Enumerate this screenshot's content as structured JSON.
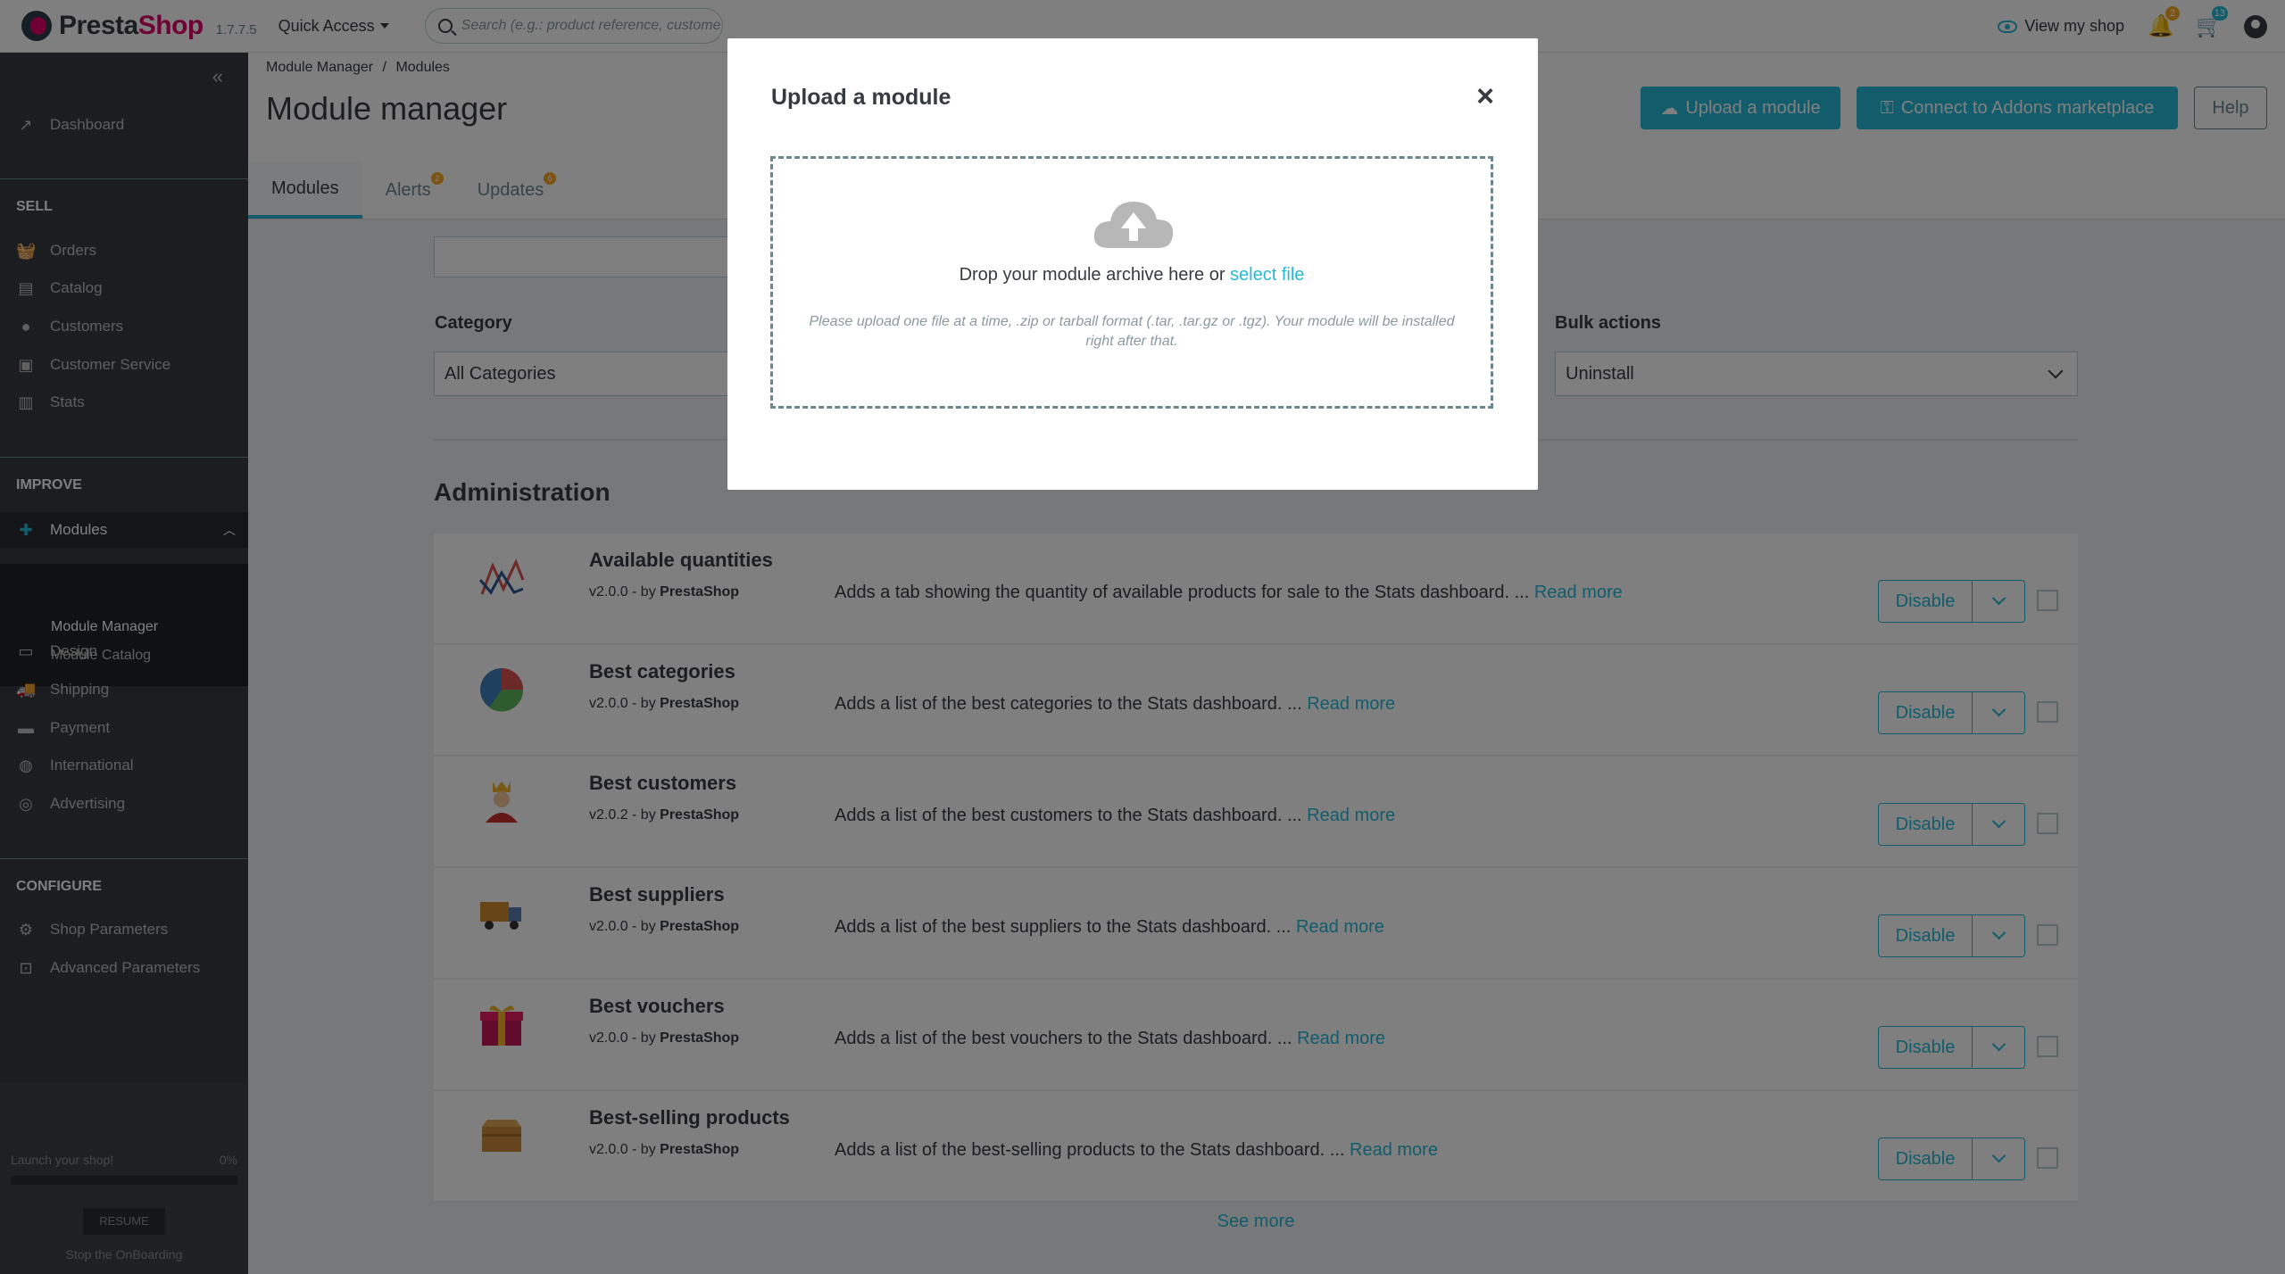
{
  "header": {
    "brand_a": "Presta",
    "brand_b": "Shop",
    "version": "1.7.7.5",
    "quick_access": "Quick Access",
    "search_placeholder": "Search (e.g.: product reference, custome",
    "view_shop": "View my shop",
    "notif_badge_1": "2",
    "notif_badge_2": "13"
  },
  "sidebar": {
    "dashboard": "Dashboard",
    "sell": "SELL",
    "orders": "Orders",
    "catalog": "Catalog",
    "customers": "Customers",
    "customer_service": "Customer Service",
    "stats": "Stats",
    "improve": "IMPROVE",
    "modules": "Modules",
    "module_manager": "Module Manager",
    "module_catalog": "Module Catalog",
    "design": "Design",
    "shipping": "Shipping",
    "payment": "Payment",
    "international": "International",
    "advertising": "Advertising",
    "configure": "CONFIGURE",
    "shop_parameters": "Shop Parameters",
    "advanced_parameters": "Advanced Parameters",
    "onboarding_label": "Launch your shop!",
    "onboarding_pct": "0%",
    "onboarding_progress": 0,
    "resume": "RESUME",
    "stop": "Stop the OnBoarding"
  },
  "page": {
    "breadcrumb_1": "Module Manager",
    "breadcrumb_sep": "/",
    "breadcrumb_2": "Modules",
    "title": "Module manager",
    "upload_btn": "Upload a module",
    "connect_btn": "Connect to Addons marketplace",
    "help_btn": "Help",
    "tabs": [
      "Modules",
      "Alerts",
      "Updates"
    ],
    "alerts_badge": "2",
    "updates_badge": "6"
  },
  "filters": {
    "category_label": "Category",
    "category_value": "All Categories",
    "bulk_label": "Bulk actions",
    "bulk_value": "Uninstall"
  },
  "section_title": "Administration",
  "modules": [
    {
      "name": "Available quantities",
      "version": "v2.0.0 - by ",
      "author": "PrestaShop",
      "desc": "Adds a tab showing the quantity of available products for sale to the Stats dashboard. ... ",
      "read_more": "Read more",
      "action": "Disable"
    },
    {
      "name": "Best categories",
      "version": "v2.0.0 - by ",
      "author": "PrestaShop",
      "desc": "Adds a list of the best categories to the Stats dashboard. ... ",
      "read_more": "Read more",
      "action": "Disable"
    },
    {
      "name": "Best customers",
      "version": "v2.0.2 - by ",
      "author": "PrestaShop",
      "desc": "Adds a list of the best customers to the Stats dashboard. ... ",
      "read_more": "Read more",
      "action": "Disable"
    },
    {
      "name": "Best suppliers",
      "version": "v2.0.0 - by ",
      "author": "PrestaShop",
      "desc": "Adds a list of the best suppliers to the Stats dashboard. ... ",
      "read_more": "Read more",
      "action": "Disable"
    },
    {
      "name": "Best vouchers",
      "version": "v2.0.0 - by ",
      "author": "PrestaShop",
      "desc": "Adds a list of the best vouchers to the Stats dashboard. ... ",
      "read_more": "Read more",
      "action": "Disable"
    },
    {
      "name": "Best-selling products",
      "version": "v2.0.0 - by ",
      "author": "PrestaShop",
      "desc": "Adds a list of the best-selling products to the Stats dashboard. ... ",
      "read_more": "Read more",
      "action": "Disable"
    }
  ],
  "see_more": "See more",
  "modal": {
    "title": "Upload a module",
    "close": "×",
    "drop_text": "Drop your module archive here or ",
    "select_file": "select file",
    "hint": "Please upload one file at a time, .zip or tarball format (.tar, .tar.gz or .tgz). Your module will be installed right after that."
  },
  "colors": {
    "accent": "#25b9d7",
    "brand": "#df0067",
    "sidebar_bg": "#363a41"
  }
}
